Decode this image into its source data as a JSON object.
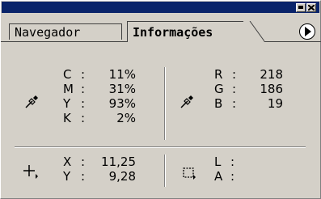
{
  "window": {
    "tabs": [
      {
        "label": "Navegador",
        "active": false
      },
      {
        "label": "Informações",
        "active": true
      }
    ],
    "titlebar_buttons": [
      "minimize-icon",
      "close-icon"
    ],
    "menu_button_icon": "triangle-right-icon",
    "colors": {
      "titlebar": "#0a246a",
      "panel": "#d4d0c8"
    }
  },
  "cmyk": {
    "icon": "eyedropper-icon",
    "c": {
      "label": "C",
      "value": "11%"
    },
    "m": {
      "label": "M",
      "value": "31%"
    },
    "y": {
      "label": "Y",
      "value": "93%"
    },
    "k": {
      "label": "K",
      "value": "2%"
    }
  },
  "rgb": {
    "icon": "eyedropper-icon",
    "r": {
      "label": "R",
      "value": "218"
    },
    "g": {
      "label": "G",
      "value": "186"
    },
    "b": {
      "label": "B",
      "value": "19"
    }
  },
  "position": {
    "icon": "crosshair-icon",
    "x": {
      "label": "X",
      "value": "11,25"
    },
    "y": {
      "label": "Y",
      "value": "9,28"
    }
  },
  "size": {
    "icon": "selection-rect-icon",
    "l": {
      "label": "L",
      "value": ""
    },
    "a": {
      "label": "A",
      "value": ""
    }
  },
  "separator": ":"
}
